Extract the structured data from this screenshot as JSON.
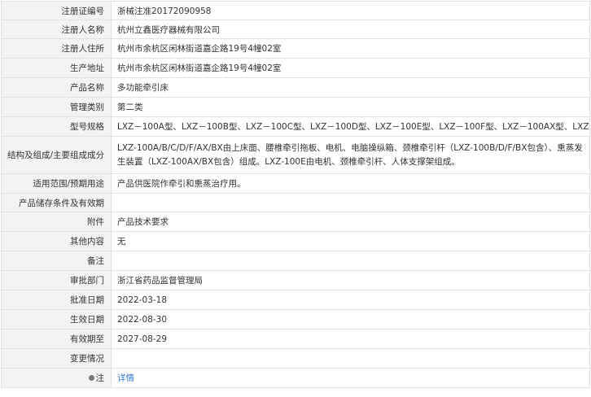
{
  "rows": [
    {
      "label": "注册证编号",
      "value": "浙械注准20172090958"
    },
    {
      "label": "注册人名称",
      "value": "杭州立鑫医疗器械有限公司"
    },
    {
      "label": "注册人住所",
      "value": "杭州市余杭区闲林街道嘉企路19号4幢02室"
    },
    {
      "label": "生产地址",
      "value": "杭州市余杭区闲林街道嘉企路19号4幢02室"
    },
    {
      "label": "产品名称",
      "value": "多功能牵引床"
    },
    {
      "label": "管理类别",
      "value": "第二类"
    },
    {
      "label": "型号规格",
      "value": "LXZ－100A型、LXZ－100B型、LXZ－100C型、LXZ－100D型、LXZ－100E型、LXZ－100F型、LXZ－100AX型、LXZ－100BX型"
    },
    {
      "label": "结构及组成/主要组成成分",
      "value": "LXZ-100A/B/C/D/F/AX/BX由上床面、腰椎牵引拖板、电机、电脑操纵箱、颈椎牵引杆（LXZ-100B/D/F/BX包含）、熏蒸发生装置（LXZ-100AX/BX包含）组成。LXZ-100E由电机、颈椎牵引杆、人体支撑架组成。"
    },
    {
      "label": "适用范围/预期用途",
      "value": "产品供医院作牵引和熏蒸治疗用。"
    },
    {
      "label": "产品储存条件及有效期",
      "value": ""
    },
    {
      "label": "附件",
      "value": "产品技术要求"
    },
    {
      "label": "其他内容",
      "value": "无"
    },
    {
      "label": "备注",
      "value": ""
    },
    {
      "label": "审批部门",
      "value": "浙江省药品监督管理局"
    },
    {
      "label": "批准日期",
      "value": "2022-03-18"
    },
    {
      "label": "生效日期",
      "value": "2022-08-30"
    },
    {
      "label": "有效期至",
      "value": "2027-08-29"
    },
    {
      "label": "变更情况",
      "value": ""
    }
  ],
  "note": {
    "label": "注",
    "link": "详情",
    "icon": "info-dot-icon"
  }
}
